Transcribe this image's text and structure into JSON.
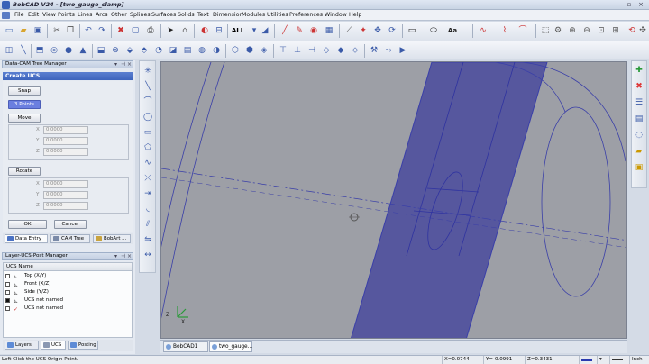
{
  "app": {
    "title": "BobCAD V24 - [two_gauge_clamp]"
  },
  "window_controls": [
    "–",
    "▫",
    "×"
  ],
  "menu": [
    "File",
    "Edit",
    "View",
    "Points",
    "Lines",
    "Arcs",
    "Other",
    "Splines",
    "Surfaces",
    "Solids",
    "Text",
    "Dimension",
    "Modules",
    "Utilities",
    "Preferences",
    "Window",
    "Help"
  ],
  "toolbar": {
    "view_filter": "ALL"
  },
  "data_cam_panel": {
    "header": "Data-CAM Tree Manager",
    "section_title": "Create UCS",
    "snap_label": "Snap",
    "three_points_label": "3 Points",
    "move_label": "Move",
    "rotate_label": "Rotate",
    "move_fields": [
      {
        "axis": "X",
        "value": "0.0000"
      },
      {
        "axis": "Y",
        "value": "0.0000"
      },
      {
        "axis": "Z",
        "value": "0.0000"
      }
    ],
    "rotate_fields": [
      {
        "axis": "X",
        "value": "0.0000"
      },
      {
        "axis": "Y",
        "value": "0.0000"
      },
      {
        "axis": "Z",
        "value": "0.0000"
      }
    ],
    "ok_label": "OK",
    "cancel_label": "Cancel",
    "tabs": [
      "Data Entry",
      "CAM Tree",
      "BobArt ..."
    ]
  },
  "ucs_panel": {
    "header": "Layer-UCS-Post Manager",
    "column_header": "UCS Name",
    "rows": [
      {
        "name": "Top (X/Y)",
        "checked": false
      },
      {
        "name": "Front (X/Z)",
        "checked": false
      },
      {
        "name": "Side (Y/Z)",
        "checked": false
      },
      {
        "name": "UCS not named",
        "checked": true
      },
      {
        "name": "UCS not named",
        "checked": false
      }
    ],
    "tabs": [
      "Layers",
      "UCS",
      "Posting"
    ]
  },
  "viewport_tabs": [
    "BobCAD1",
    "two_gauge..."
  ],
  "status": {
    "message": "Left Click the UCS Origin Point.",
    "x": "X=0.0744",
    "y": "Y=-0.0991",
    "z": "Z=0.3431",
    "units": "Inch"
  },
  "colors": {
    "viewport_bg": "#9d9fa6",
    "geometry": "#3a3fa8",
    "part_fill": "#56579e",
    "selected_button": "#6b7fe0"
  }
}
